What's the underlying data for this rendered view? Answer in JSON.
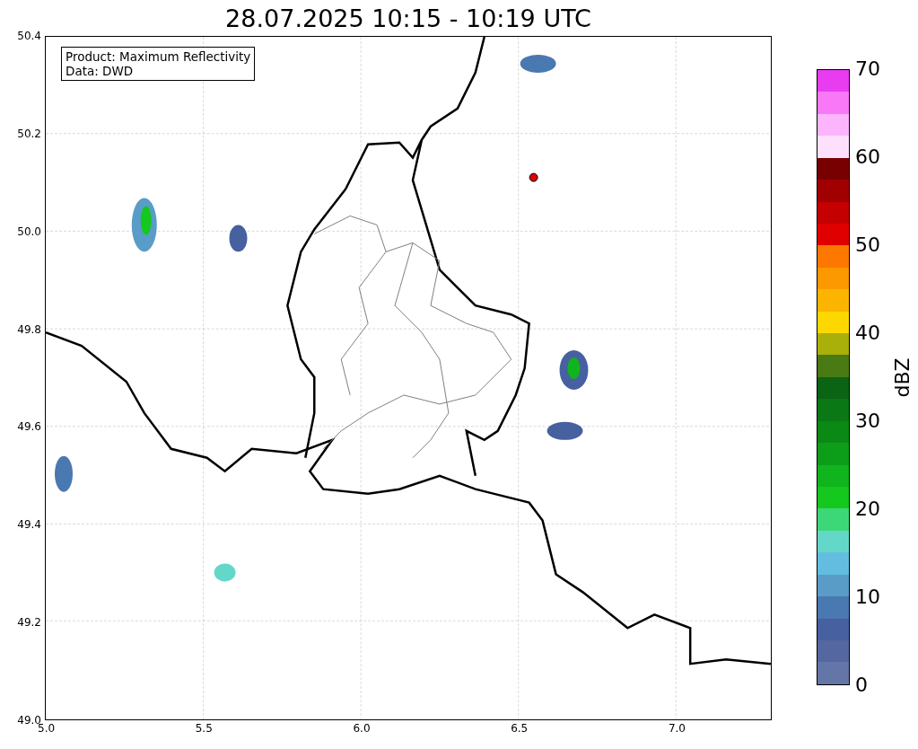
{
  "title": "28.07.2025 10:15 - 10:19 UTC",
  "info_box": [
    "Product: Maximum Reflectivity",
    "Data: DWD"
  ],
  "x_axis": {
    "ticks": [
      "5.0",
      "5.5",
      "6.0",
      "6.5",
      "7.0"
    ]
  },
  "y_axis": {
    "ticks": [
      "50.4",
      "50.2",
      "50.0",
      "49.8",
      "49.6",
      "49.4",
      "49.2",
      "49.0"
    ]
  },
  "colorbar": {
    "label": "dBZ",
    "ticks": [
      "70",
      "60",
      "50",
      "40",
      "30",
      "20",
      "10",
      "0"
    ],
    "steps": [
      {
        "color": "#e83cf0"
      },
      {
        "color": "#f878f8"
      },
      {
        "color": "#fcb4fc"
      },
      {
        "color": "#fce0fc"
      },
      {
        "color": "#780000"
      },
      {
        "color": "#a00000"
      },
      {
        "color": "#c40000"
      },
      {
        "color": "#e00000"
      },
      {
        "color": "#fc7800"
      },
      {
        "color": "#fc9800"
      },
      {
        "color": "#fcb400"
      },
      {
        "color": "#fcd800"
      },
      {
        "color": "#aab00a"
      },
      {
        "color": "#4a7a14"
      },
      {
        "color": "#0a6414"
      },
      {
        "color": "#0a7814"
      },
      {
        "color": "#0a8a14"
      },
      {
        "color": "#0c9e18"
      },
      {
        "color": "#10b41c"
      },
      {
        "color": "#14c81e"
      },
      {
        "color": "#3cd878"
      },
      {
        "color": "#64d8c8"
      },
      {
        "color": "#63bde0"
      },
      {
        "color": "#5a9cc8"
      },
      {
        "color": "#4a78b0"
      },
      {
        "color": "#4660a0"
      },
      {
        "color": "#5567a0"
      },
      {
        "color": "#6476a8"
      }
    ]
  }
}
